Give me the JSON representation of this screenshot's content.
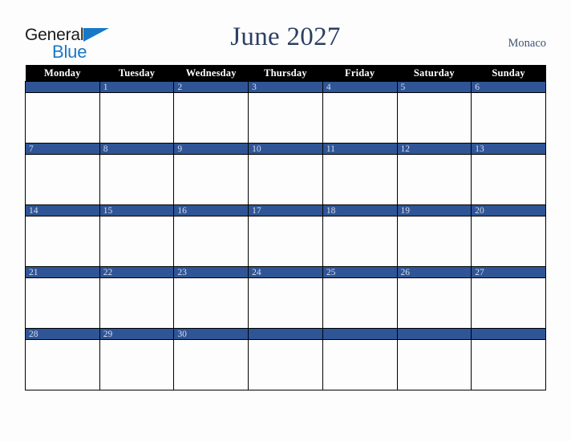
{
  "brand": {
    "word1": "General",
    "word2": "Blue",
    "triangle_color": "#1878c8"
  },
  "header": {
    "title": "June 2027",
    "country": "Monaco",
    "title_color": "#2b3f63"
  },
  "calendar": {
    "weekday_headers": [
      "Monday",
      "Tuesday",
      "Wednesday",
      "Thursday",
      "Friday",
      "Saturday",
      "Sunday"
    ],
    "accent_color": "#2f5597",
    "header_bg": "#000000",
    "weeks": [
      [
        "",
        "1",
        "2",
        "3",
        "4",
        "5",
        "6"
      ],
      [
        "7",
        "8",
        "9",
        "10",
        "11",
        "12",
        "13"
      ],
      [
        "14",
        "15",
        "16",
        "17",
        "18",
        "19",
        "20"
      ],
      [
        "21",
        "22",
        "23",
        "24",
        "25",
        "26",
        "27"
      ],
      [
        "28",
        "29",
        "30",
        "",
        "",
        "",
        ""
      ]
    ]
  }
}
